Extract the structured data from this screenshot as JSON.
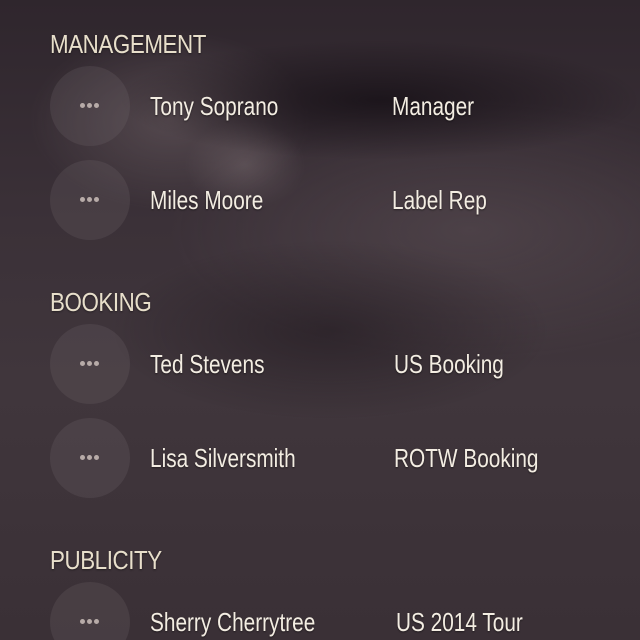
{
  "sections": [
    {
      "title": "MANAGEMENT",
      "contacts": [
        {
          "name": "Tony Soprano",
          "role": "Manager"
        },
        {
          "name": "Miles Moore",
          "role": "Label Rep"
        }
      ]
    },
    {
      "title": "BOOKING",
      "contacts": [
        {
          "name": "Ted Stevens",
          "role": "US Booking"
        },
        {
          "name": "Lisa Silversmith",
          "role": "ROTW Booking"
        }
      ]
    },
    {
      "title": "PUBLICITY",
      "contacts": [
        {
          "name": "Sherry Cherrytree",
          "role": "US 2014 Tour"
        }
      ]
    }
  ],
  "icons": {
    "more": "more-horizontal-icon"
  }
}
